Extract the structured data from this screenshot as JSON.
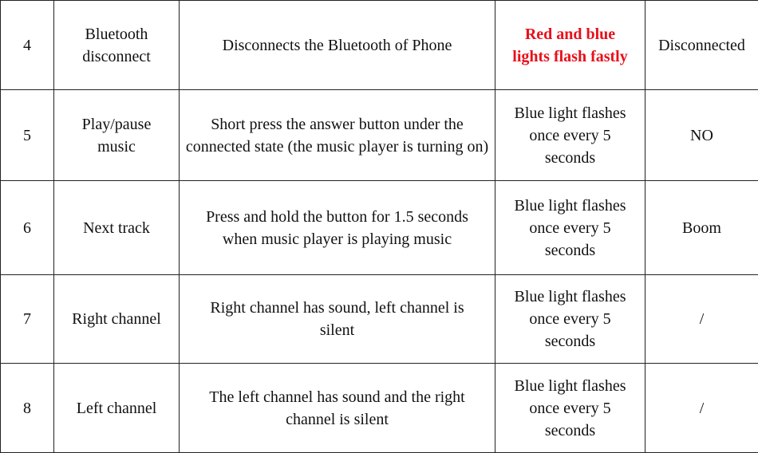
{
  "colors": {
    "highlight_text": "#e8101a"
  },
  "rows": [
    {
      "no": "4",
      "function": "Bluetooth disconnect",
      "operation": "Disconnects the Bluetooth of Phone",
      "indicator": "Red and blue lights flash fastly",
      "indicator_highlight": true,
      "prompt": "Disconnected"
    },
    {
      "no": "5",
      "function": "Play/pause music",
      "operation": "Short press the answer button under the connected state (the music player is turning on)",
      "indicator": "Blue light flashes once every 5 seconds",
      "indicator_highlight": false,
      "prompt": "NO"
    },
    {
      "no": "6",
      "function": "Next track",
      "operation": "Press and hold the button for 1.5 seconds when music player is playing music",
      "indicator": "Blue light flashes once every 5 seconds",
      "indicator_highlight": false,
      "prompt": "Boom"
    },
    {
      "no": "7",
      "function": "Right channel",
      "operation": "Right channel has sound, left channel is silent",
      "indicator": "Blue light flashes once every 5 seconds",
      "indicator_highlight": false,
      "prompt": "/"
    },
    {
      "no": "8",
      "function": "Left channel",
      "operation": "The left channel has sound and the right channel is silent",
      "indicator": "Blue light flashes once every 5 seconds",
      "indicator_highlight": false,
      "prompt": "/"
    }
  ]
}
